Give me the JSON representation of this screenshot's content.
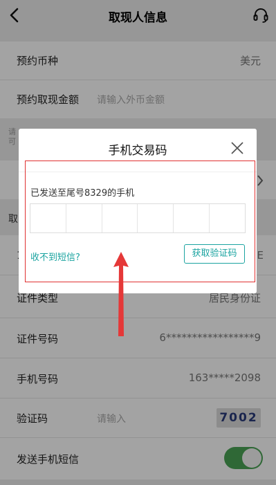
{
  "header": {
    "title": "取现人信息"
  },
  "form": {
    "currency_label": "预约币种",
    "currency_value": "美元",
    "amount_label": "预约取现金额",
    "amount_placeholder": "请输入外币金额",
    "hint_line1": "请",
    "hint_line2": "可",
    "section_label": "取",
    "name_prefix": "1",
    "name_suffix": "E",
    "id_type_label": "证件类型",
    "id_type_value": "居民身份证",
    "id_number_label": "证件号码",
    "id_number_value": "6*****************9",
    "phone_label": "手机号码",
    "phone_value": "163*****2098",
    "captcha_label": "验证码",
    "captcha_placeholder": "请输入",
    "captcha_text": "7002",
    "sms_label": "发送手机短信",
    "sms_enabled": true
  },
  "modal": {
    "title": "手机交易码",
    "sent_text": "已发送至尾号8329的手机",
    "code_digits": 6,
    "no_sms_link": "收不到短信?",
    "get_code_button": "获取验证码"
  },
  "colors": {
    "accent": "#1aa3a0",
    "toggle_on": "#4aa355",
    "highlight": "#e03030"
  }
}
